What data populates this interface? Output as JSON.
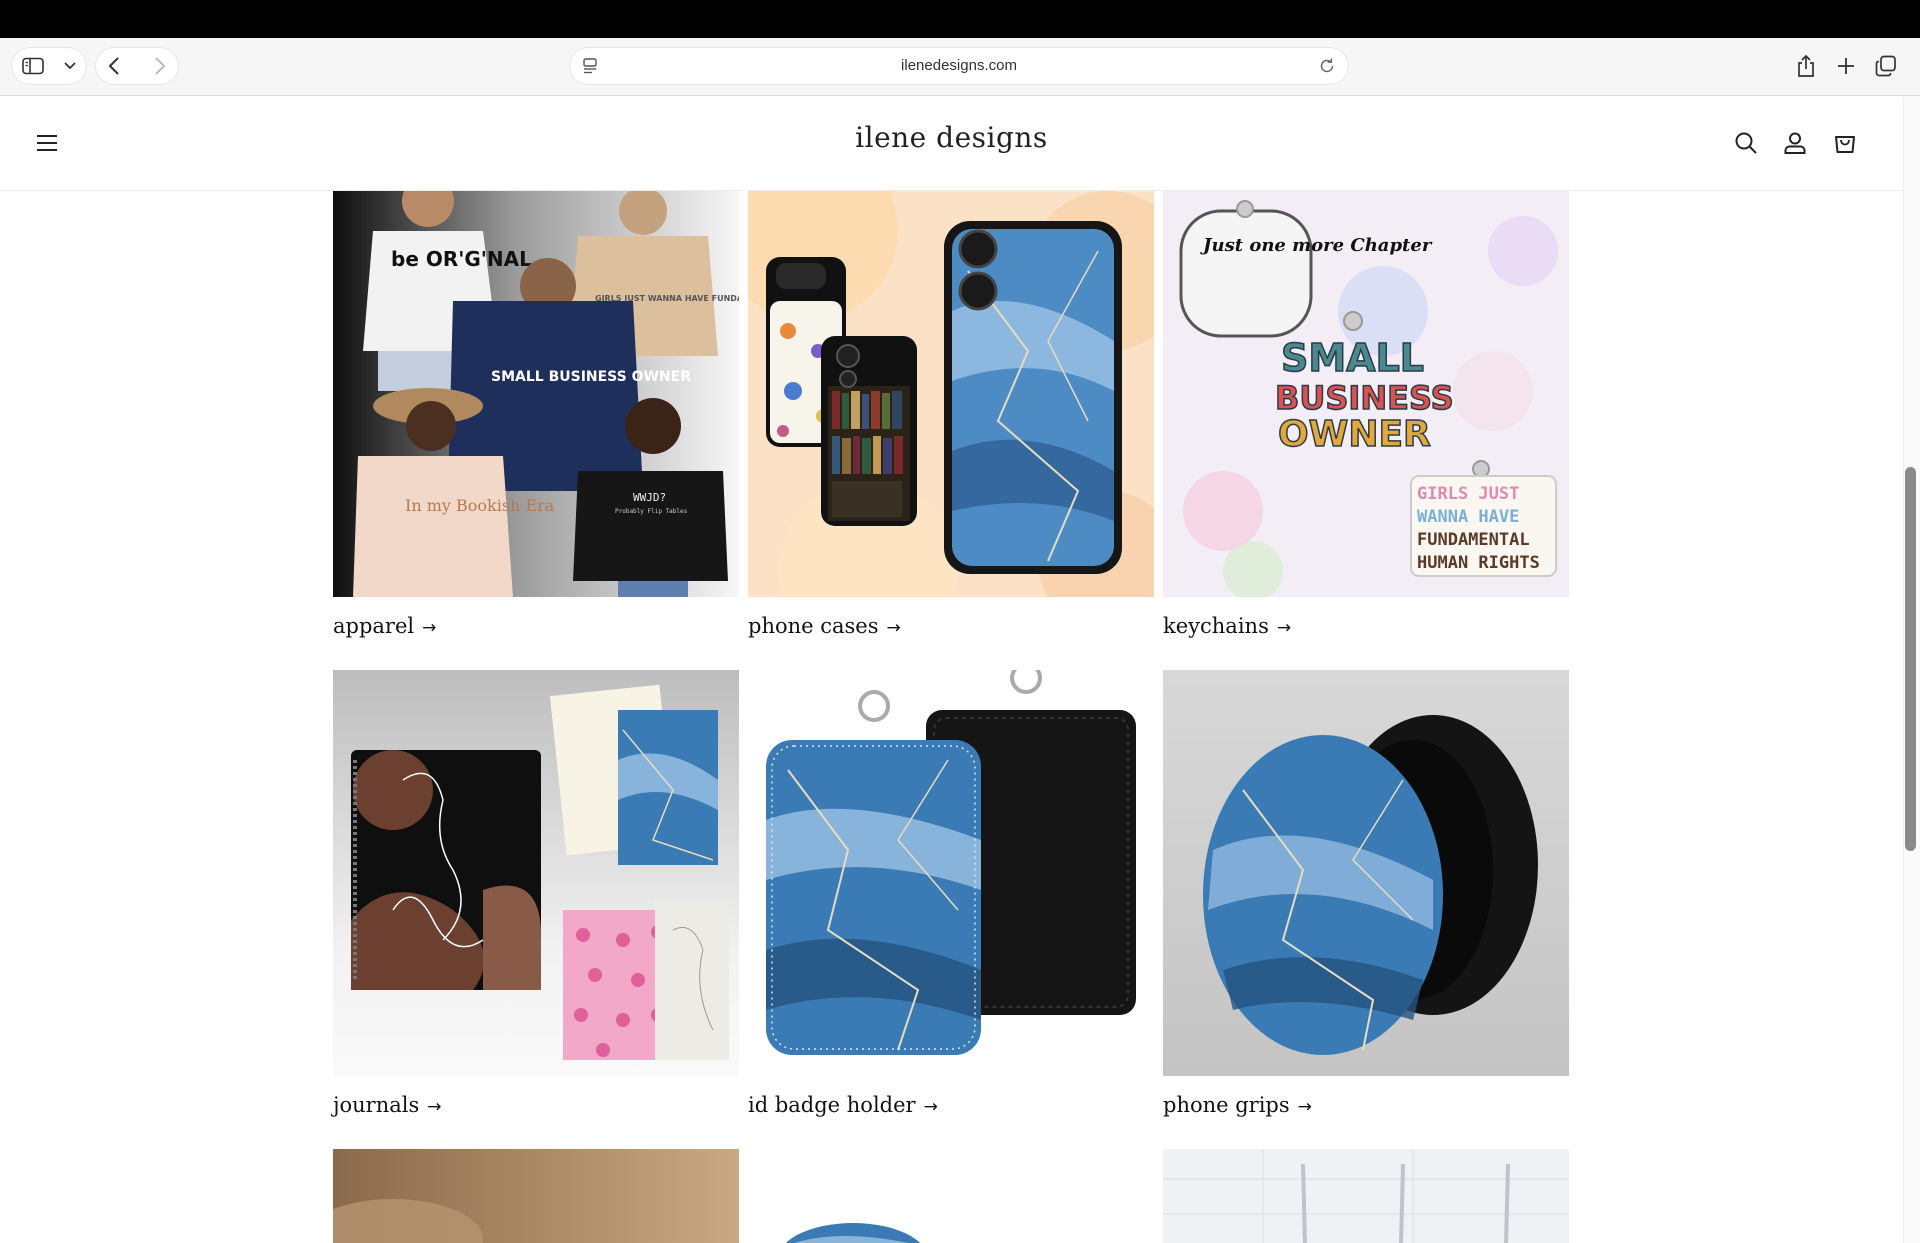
{
  "browser": {
    "url": "ilenedesigns.com",
    "icons": [
      "sidebar-icon",
      "chevron-down-icon",
      "back-icon",
      "forward-icon",
      "reader-icon",
      "reload-icon",
      "share-icon",
      "new-tab-icon",
      "tabs-overview-icon"
    ]
  },
  "header": {
    "brand": "ilene designs",
    "icons": [
      "hamburger-menu-icon",
      "search-icon",
      "account-icon",
      "cart-icon"
    ]
  },
  "collections": [
    {
      "label": "apparel",
      "arrow": "→"
    },
    {
      "label": "phone cases",
      "arrow": "→"
    },
    {
      "label": "keychains",
      "arrow": "→"
    },
    {
      "label": "journals",
      "arrow": "→"
    },
    {
      "label": "id badge holder",
      "arrow": "→"
    },
    {
      "label": "phone grips",
      "arrow": "→"
    }
  ],
  "image_text": {
    "apparel_shirt": "be OR'G'NAL",
    "apparel_hoodie": "SMALL BUSINESS OWNER",
    "apparel_tee1": "GIRLS JUST WANNA HAVE FUNDAMENTAL HUMAN RIGHTS",
    "apparel_tee2": "In my Bookish Era",
    "apparel_sweat": "WWJD?",
    "apparel_sweat_sub": "Probably Flip Tables",
    "keychain1": "Just one more Chapter",
    "keychain2a": "SMALL",
    "keychain2b": "BUSINESS",
    "keychain2c": "OWNER",
    "keychain3a": "GIRLS JUST",
    "keychain3b": "WANNA HAVE",
    "keychain3c": "FUNDAMENTAL",
    "keychain3d": "HUMAN RIGHTS"
  },
  "colors": {
    "marble_blue": "#3a7bb5",
    "marble_light": "#9cc3e6",
    "hoodie_navy": "#1f2f5c",
    "journal_brown": "#6b4030",
    "bow_pink": "#f2a9c7"
  }
}
